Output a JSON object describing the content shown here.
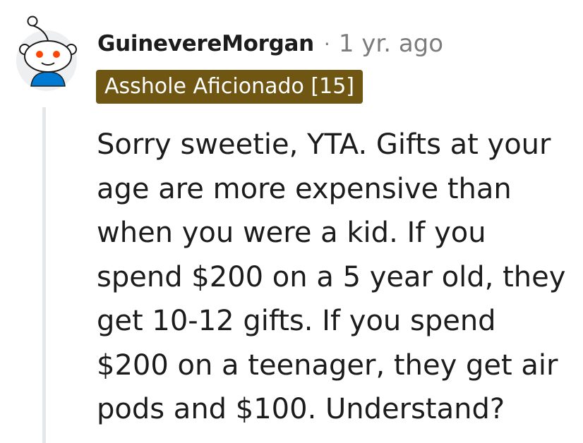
{
  "comment": {
    "username": "GuinevereMorgan",
    "separator": "·",
    "timestamp": "1 yr. ago",
    "flair": {
      "text": "Asshole Aficionado [15]",
      "background_color": "#6f5613",
      "text_color": "#ffffff"
    },
    "avatar_icon": "snoo-avatar-icon",
    "body_lines": [
      "Sorry sweetie, YTA. Gifts at your",
      "age are more expensive than",
      "when you were a kid. If you",
      "spend $200 on a 5 year old, they",
      "get 10-12 gifts. If you spend",
      "$200 on a teenager, they get air",
      "pods and $100. Understand?"
    ]
  },
  "colors": {
    "text": "#1c1c1c",
    "meta_gray": "#7c7c7c",
    "thread_line": "#e5e8ea",
    "avatar_bg": "#edeff1",
    "avatar_shirt": "#0079d3",
    "avatar_eye": "#ff4500"
  }
}
